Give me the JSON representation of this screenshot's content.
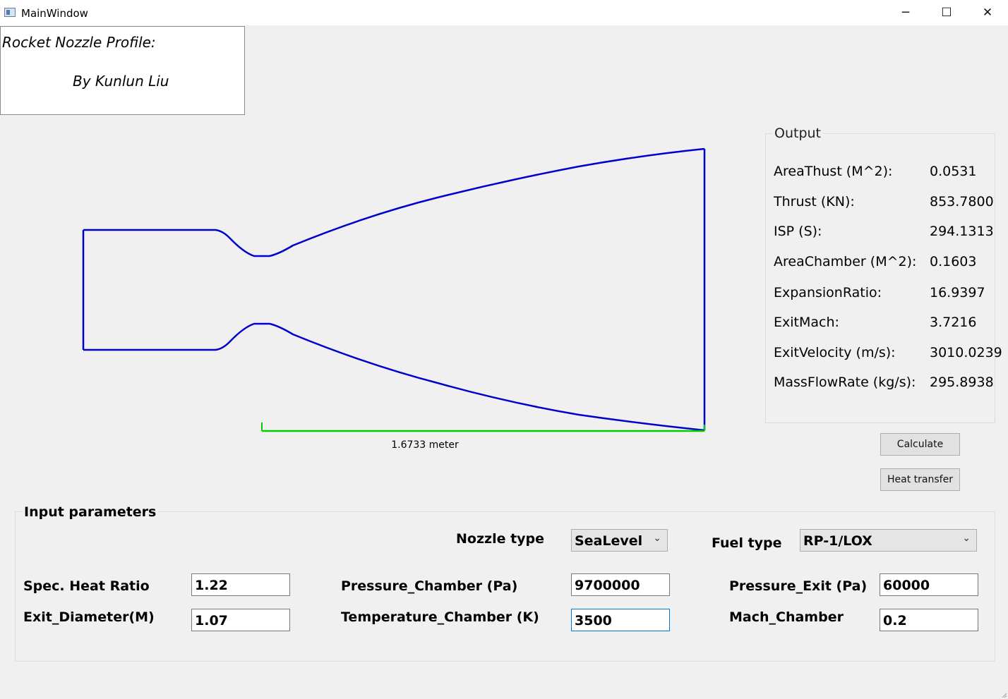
{
  "window": {
    "title": "MainWindow",
    "minimize": "─",
    "maximize": "☐",
    "close": "✕"
  },
  "header": {
    "line1": "Rocket Nozzle Profile:",
    "line2": "By Kunlun Liu"
  },
  "plot": {
    "length_label": "1.6733 meter",
    "profile_color": "#0000cc",
    "scale_color": "#00cc00"
  },
  "output": {
    "title": "Output",
    "rows": [
      {
        "label": "AreaThust (M^2):",
        "value": "0.0531"
      },
      {
        "label": "Thrust (KN):",
        "value": "853.7800"
      },
      {
        "label": "ISP (S):",
        "value": "294.1313"
      },
      {
        "label": "AreaChamber (M^2):",
        "value": "0.1603"
      },
      {
        "label": "ExpansionRatio:",
        "value": "16.9397"
      },
      {
        "label": "ExitMach:",
        "value": "3.7216"
      },
      {
        "label": "ExitVelocity (m/s):",
        "value": "3010.0239"
      },
      {
        "label": "MassFlowRate (kg/s):",
        "value": "295.8938"
      }
    ]
  },
  "buttons": {
    "calculate": "Calculate",
    "heat_transfer": "Heat transfer"
  },
  "input": {
    "title": "Input parameters",
    "nozzle_type_label": "Nozzle type",
    "nozzle_type_value": "SeaLevel",
    "fuel_type_label": "Fuel type",
    "fuel_type_value": "RP-1/LOX",
    "spec_heat_ratio_label": "Spec. Heat Ratio",
    "spec_heat_ratio_value": "1.22",
    "exit_diameter_label": "Exit_Diameter(M)",
    "exit_diameter_value": "1.07",
    "pressure_chamber_label": "Pressure_Chamber (Pa)",
    "pressure_chamber_value": "9700000",
    "temperature_chamber_label": "Temperature_Chamber (K)",
    "temperature_chamber_value": "3500",
    "pressure_exit_label": "Pressure_Exit (Pa)",
    "pressure_exit_value": "60000",
    "mach_chamber_label": "Mach_Chamber",
    "mach_chamber_value": "0.2"
  }
}
